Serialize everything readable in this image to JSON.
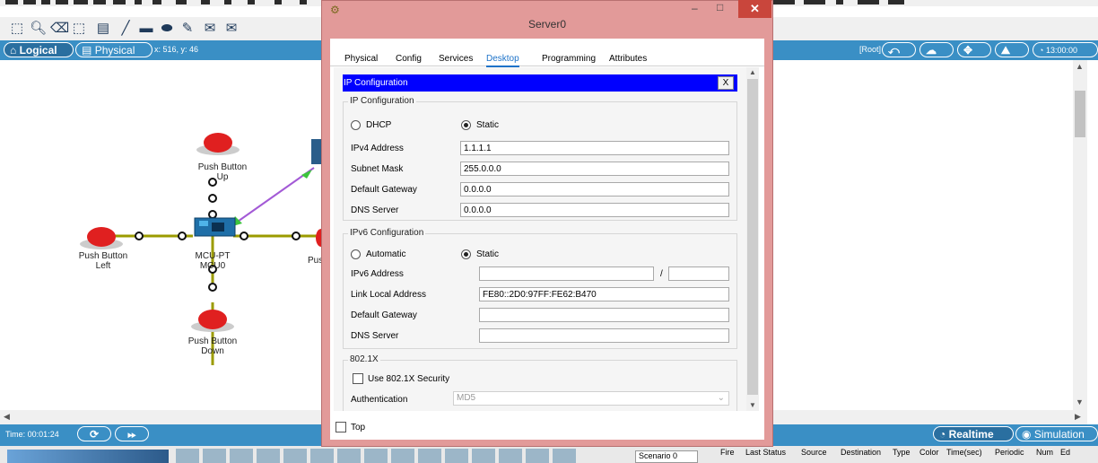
{
  "toolbar": {
    "icons": [
      "select-icon",
      "inspect-icon",
      "delete-icon",
      "resize-icon",
      "note-icon",
      "line-icon",
      "rectangle-icon",
      "ellipse-icon",
      "freehand-icon",
      "simple-pdu-icon",
      "complex-pdu-icon"
    ]
  },
  "logical_bar": {
    "logical_label": "Logical",
    "physical_label": "Physical",
    "coords": "x: 516, y: 46",
    "root_label": "[Root]",
    "time": "13:00:00"
  },
  "workspace": {
    "devices": [
      {
        "label1": "Push Button",
        "label2": "Up"
      },
      {
        "label1": "Push Button",
        "label2": "Left"
      },
      {
        "label1": "MCU-PT",
        "label2": "MCU0"
      },
      {
        "label1": "Push Button",
        "label2": "Down"
      },
      {
        "label1": "Pus",
        "label2": ""
      }
    ]
  },
  "timebar": {
    "time": "Time: 00:01:24",
    "realtime": "Realtime",
    "simulation": "Simulation"
  },
  "bottom": {
    "headers": [
      "Fire",
      "Last Status",
      "Source",
      "Destination",
      "Type",
      "Color",
      "Time(sec)",
      "Periodic",
      "Num",
      "Ed"
    ],
    "scenario": "Scenario 0"
  },
  "dialog": {
    "title": "Server0",
    "tabs": [
      "Physical",
      "Config",
      "Services",
      "Desktop",
      "Programming",
      "Attributes"
    ],
    "active_tab": "Desktop",
    "panel_title": "IP Configuration",
    "close_x": "X",
    "ipconf": {
      "group": "IP Configuration",
      "dhcp": "DHCP",
      "static": "Static",
      "ipv4_label": "IPv4 Address",
      "ipv4": "1.1.1.1",
      "mask_label": "Subnet Mask",
      "mask": "255.0.0.0",
      "gw_label": "Default Gateway",
      "gw": "0.0.0.0",
      "dns_label": "DNS Server",
      "dns": "0.0.0.0"
    },
    "ipv6": {
      "group": "IPv6 Configuration",
      "auto": "Automatic",
      "static": "Static",
      "addr_label": "IPv6 Address",
      "addr": "",
      "slash": "/",
      "prefix": "",
      "lla_label": "Link Local Address",
      "lla": "FE80::2D0:97FF:FE62:B470",
      "gw_label": "Default Gateway",
      "gw": "",
      "dns_label": "DNS Server",
      "dns": ""
    },
    "dot1x": {
      "group": "802.1X",
      "use_label": "Use 802.1X Security",
      "auth_label": "Authentication",
      "auth_value": "MD5"
    },
    "top_label": "Top"
  }
}
